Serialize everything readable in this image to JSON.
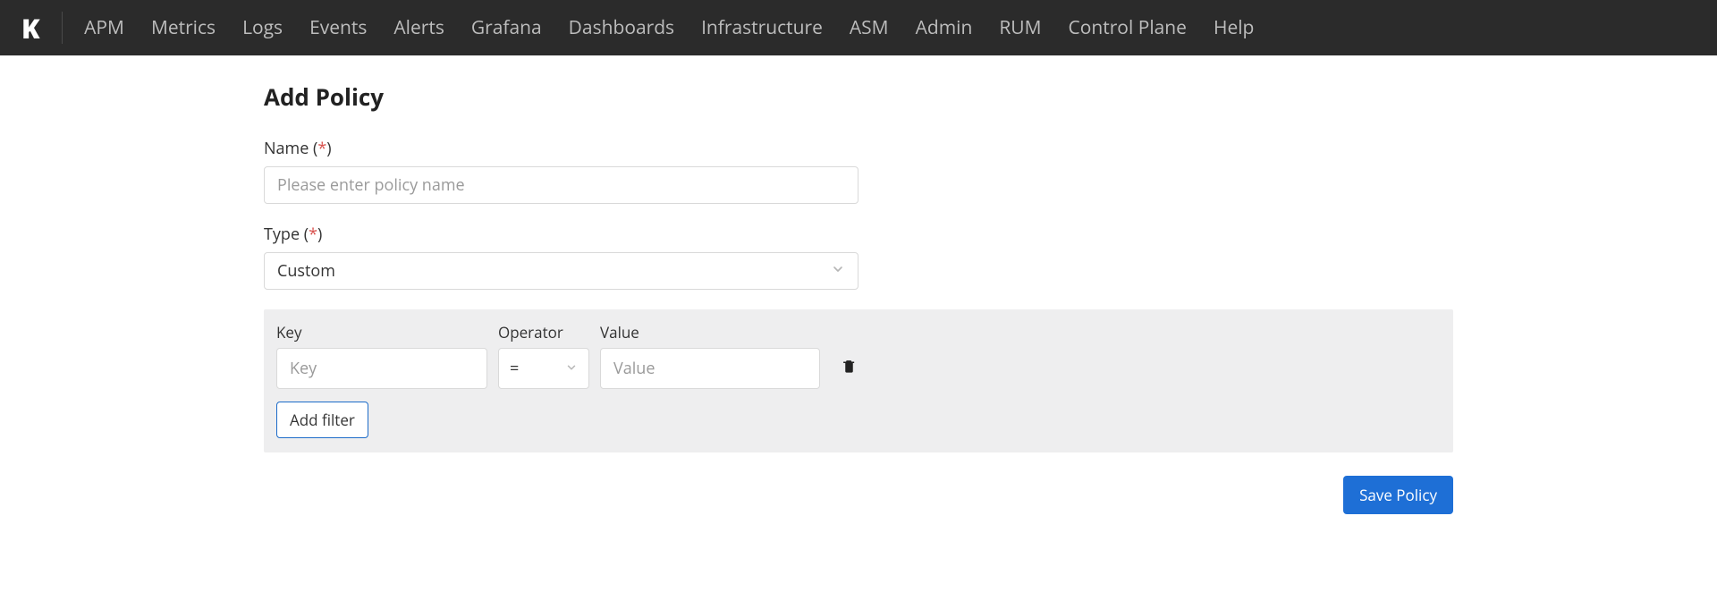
{
  "brand": {
    "logo_letter": "K"
  },
  "nav": {
    "items": [
      "APM",
      "Metrics",
      "Logs",
      "Events",
      "Alerts",
      "Grafana",
      "Dashboards",
      "Infrastructure",
      "ASM",
      "Admin",
      "RUM",
      "Control Plane",
      "Help"
    ]
  },
  "page": {
    "title": "Add Policy"
  },
  "form": {
    "name": {
      "label": "Name",
      "required_marker": "*",
      "placeholder": "Please enter policy name",
      "value": ""
    },
    "type": {
      "label": "Type",
      "required_marker": "*",
      "selected": "Custom"
    }
  },
  "filter_panel": {
    "columns": {
      "key": "Key",
      "operator": "Operator",
      "value": "Value"
    },
    "row": {
      "key_placeholder": "Key",
      "key_value": "",
      "operator_selected": "=",
      "value_placeholder": "Value",
      "value_value": ""
    },
    "add_filter_label": "Add filter",
    "delete_icon_name": "trash-icon"
  },
  "actions": {
    "save_label": "Save Policy"
  }
}
